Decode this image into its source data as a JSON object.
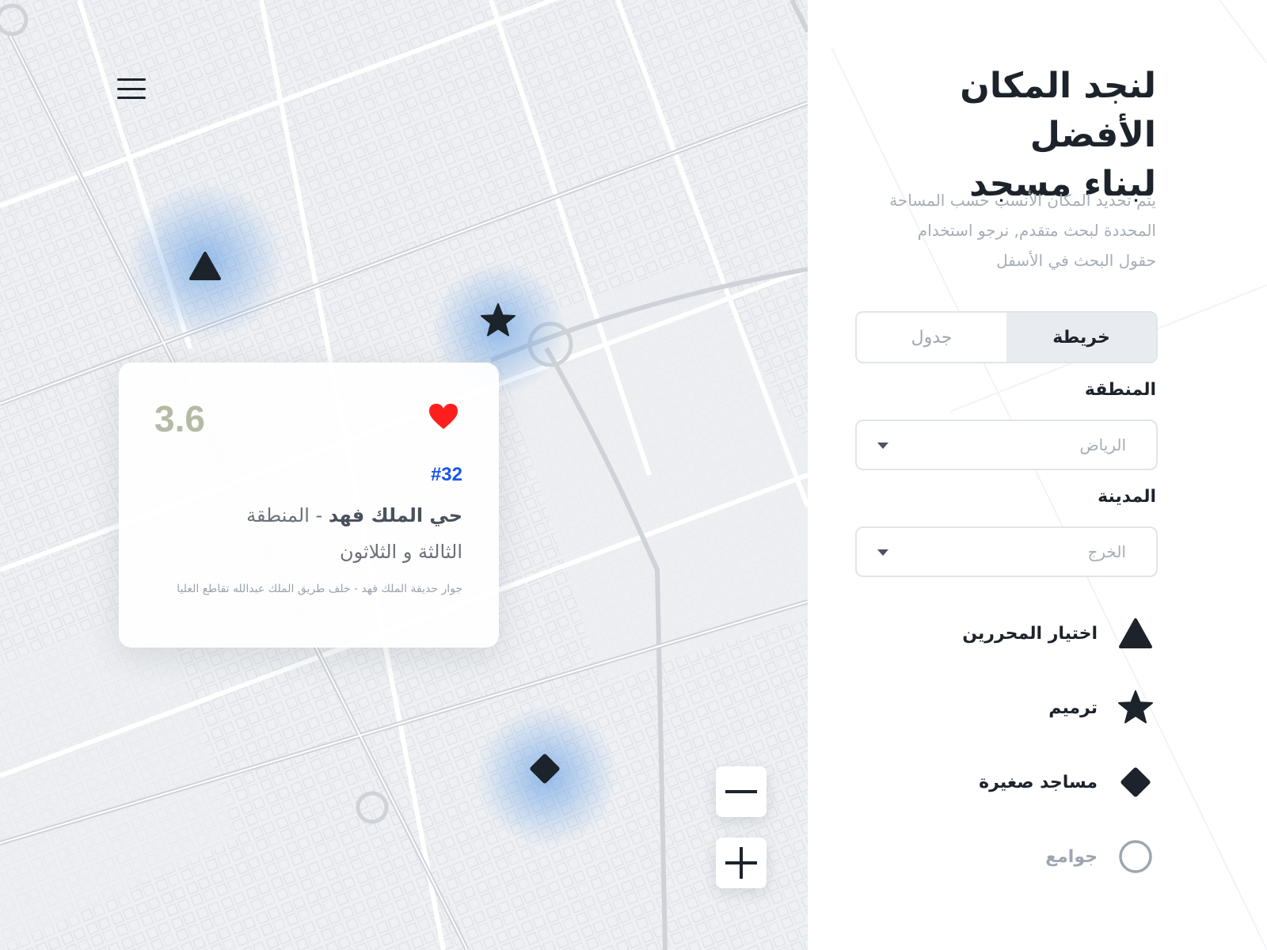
{
  "map": {
    "menu_icon": "hamburger-menu-icon",
    "markers": [
      {
        "shape": "triangle",
        "icon": "triangle-marker-icon",
        "category": "اختيار المحررين"
      },
      {
        "shape": "star",
        "icon": "star-marker-icon",
        "category": "ترميم"
      },
      {
        "shape": "diamond",
        "icon": "diamond-marker-icon",
        "category": "مساجد صغيرة"
      }
    ],
    "zoom_out_icon": "minus-icon",
    "zoom_in_icon": "plus-icon",
    "accent_glow": "#4a90e2"
  },
  "card": {
    "rating": "3.6",
    "favorite_icon": "heart-icon",
    "favorite_color": "#ff1e1e",
    "number": "#32",
    "title_bold": "حي الملك فهد",
    "title_rest": "- المنطقة",
    "title_line2": "الثالثة و الثلاثون",
    "address": "جوار حديقة الملك فهد - خلف طريق الملك عبدالله تقاطع العليا"
  },
  "panel": {
    "headline_line1": "لنجد المكان الأفضل",
    "headline_line2": "لبناء مسجد",
    "desc_line1": "يتم تحديد المكان الأنسب حسب المساحة",
    "desc_line2": "المحددة  لبحث متقدم, نرجو استخدام",
    "desc_line3": "حقول البحث في الأسفل",
    "tabs": {
      "map": "خريطة",
      "table": "جدول",
      "active": "map"
    },
    "region_label": "المنطقة",
    "region_value": "الرياض",
    "city_label": "المدينة",
    "city_value": "الخرج",
    "legend": [
      {
        "icon": "triangle-icon",
        "label": "اختيار المحررين"
      },
      {
        "icon": "star-icon",
        "label": "ترميم"
      },
      {
        "icon": "diamond-icon",
        "label": "مساجد صغيرة"
      },
      {
        "icon": "circle-outline-icon",
        "label": "جوامع"
      }
    ],
    "text_color": "#1d232b",
    "muted_color": "#a6adb7"
  }
}
